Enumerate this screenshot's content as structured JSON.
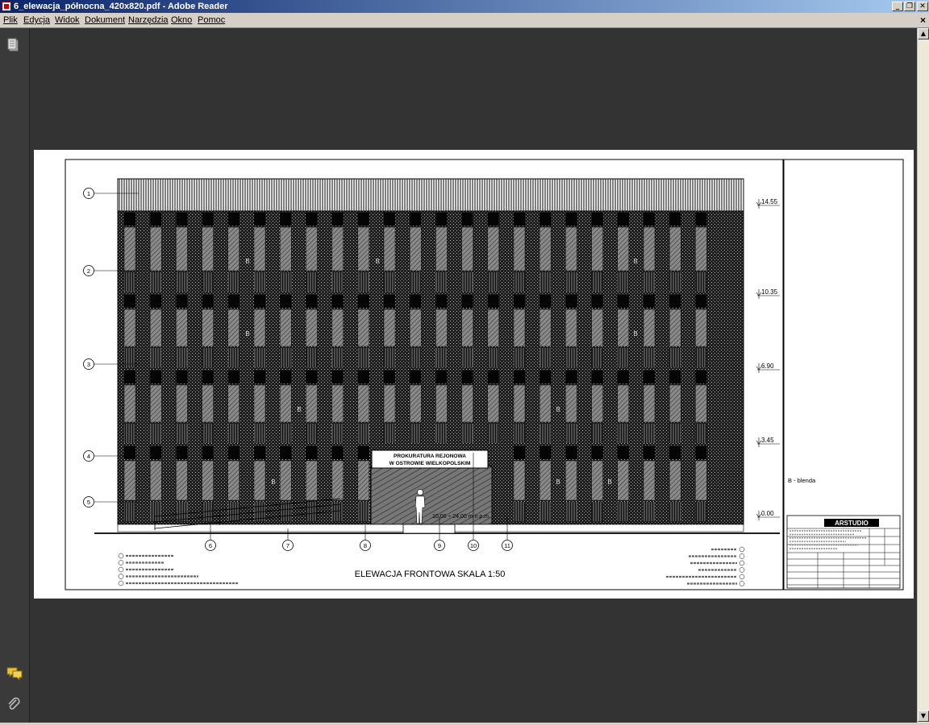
{
  "window": {
    "title": "6_elewacja_północna_420x820.pdf - Adobe Reader",
    "minimize_glyph": "_",
    "maximize_glyph": "❐",
    "close_glyph": "✕"
  },
  "menu": {
    "items": [
      "Plik",
      "Edycja",
      "Widok",
      "Dokument",
      "Narzędzia",
      "Okno",
      "Pomoc"
    ],
    "close_glyph": "×"
  },
  "sidebar": {
    "icons": [
      "pages-icon",
      "comments-icon",
      "attachments-icon"
    ]
  },
  "drawing": {
    "sign_line1": "PROKURATURA REJONOWA",
    "sign_line2": "W OSTROWIE WIELKOPOLSKIM",
    "title": "ELEWACJA FRONTOWA  SKALA 1:50",
    "levels": [
      "14.55",
      "10.35",
      "6.90",
      "3.45",
      "0.00"
    ],
    "left_callouts": [
      "1",
      "2",
      "3",
      "4",
      "5"
    ],
    "bottom_callouts": [
      "6",
      "7",
      "8",
      "9",
      "10",
      "11"
    ],
    "panel_mark": "B",
    "ramp_label": "10.00 ÷ 24.00 m n.p.m.",
    "legend_note": "B - blenda",
    "logo": "ARSTUDIO"
  },
  "colors": {
    "title_gradient_start": "#0a246a",
    "title_gradient_end": "#a6caf0",
    "chrome": "#d4d0c8",
    "doc_background": "#333333",
    "page": "#ffffff"
  }
}
